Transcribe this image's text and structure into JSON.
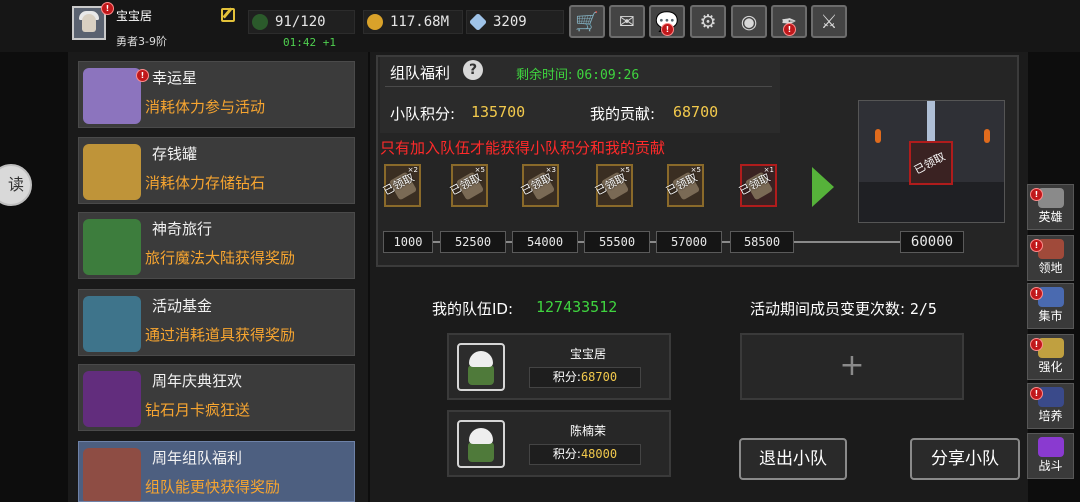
{
  "player": {
    "name": "宝宝居",
    "level": "勇者3-9阶",
    "regen": "01:42 +1"
  },
  "stats": {
    "energy": "91/120",
    "gold": "117.68M",
    "diamonds": "3209"
  },
  "top_buttons": [
    {
      "icon": "cart-icon",
      "glyph": "🛒",
      "alert": false
    },
    {
      "icon": "mail-icon",
      "glyph": "✉",
      "alert": false
    },
    {
      "icon": "chat-icon",
      "glyph": "💬",
      "alert": true
    },
    {
      "icon": "settings-icon",
      "glyph": "⚙",
      "alert": false
    },
    {
      "icon": "color-wheel-icon",
      "glyph": "◉",
      "alert": false
    },
    {
      "icon": "feather-icon",
      "glyph": "✒",
      "alert": true
    },
    {
      "icon": "swords-icon",
      "glyph": "⚔",
      "alert": false
    }
  ],
  "side_events": [
    {
      "title": "幸运星",
      "desc": "消耗体力参与活动",
      "alert": true,
      "color": "#9b7fd6"
    },
    {
      "title": "存钱罐",
      "desc": "消耗体力存储钻石",
      "alert": false,
      "color": "#d7a43a"
    },
    {
      "title": "神奇旅行",
      "desc": "旅行魔法大陆获得奖励",
      "alert": false,
      "color": "#3e8a3e"
    },
    {
      "title": "活动基金",
      "desc": "通过消耗道具获得奖励",
      "alert": false,
      "color": "#3f7f9a"
    },
    {
      "title": "周年庆典狂欢",
      "desc": "钻石月卡疯狂送",
      "alert": false,
      "color": "#6a2b8a"
    },
    {
      "title": "周年组队福利",
      "desc": "组队能更快获得奖励",
      "alert": false,
      "color": "#9a4a3a"
    }
  ],
  "team_welfare": {
    "title": "组队福利",
    "help": "?",
    "remain_label": "剩余时间:",
    "remain_value": "06:09:26",
    "team_score_label": "小队积分:",
    "team_score": "135700",
    "contrib_label": "我的贡献:",
    "contrib": "68700",
    "warning": "只有加入队伍才能获得小队积分和我的贡献",
    "slots": [
      {
        "claimed": "已领取",
        "count": "×2",
        "red": false
      },
      {
        "claimed": "已领取",
        "count": "×5",
        "red": false
      },
      {
        "claimed": "已领取",
        "count": "×3",
        "red": false
      },
      {
        "claimed": "已领取",
        "count": "×5",
        "red": false
      },
      {
        "claimed": "已领取",
        "count": "×5",
        "red": false
      },
      {
        "claimed": "已领取",
        "count": "×1",
        "red": true
      }
    ],
    "milestones": [
      "1000",
      "52500",
      "54000",
      "55500",
      "57000",
      "58500",
      "60000"
    ],
    "grand_claimed": "已领取"
  },
  "team": {
    "id_label": "我的队伍ID:",
    "id_value": "127433512",
    "changes_label": "活动期间成员变更次数:",
    "changes_value": "2/5",
    "score_label": "积分:",
    "members": [
      {
        "name": "宝宝居",
        "score": "68700"
      },
      {
        "name": "陈楠茉",
        "score": "48000"
      }
    ],
    "add_symbol": "+"
  },
  "actions": {
    "leave": "退出小队",
    "share": "分享小队"
  },
  "right_nav": [
    {
      "label": "英雄",
      "icon": "hero-icon",
      "color": "#8a8a8a",
      "alert": true
    },
    {
      "label": "领地",
      "icon": "castle-icon",
      "color": "#a04a3a",
      "alert": true
    },
    {
      "label": "集市",
      "icon": "market-icon",
      "color": "#4a6ab0",
      "alert": true
    },
    {
      "label": "强化",
      "icon": "enhance-icon",
      "color": "#c0a040",
      "alert": true
    },
    {
      "label": "培养",
      "icon": "train-icon",
      "color": "#3a4a8a",
      "alert": true
    },
    {
      "label": "战斗",
      "icon": "battle-icon",
      "color": "#8a3ad0",
      "alert": false
    }
  ],
  "reading_badge": "读"
}
